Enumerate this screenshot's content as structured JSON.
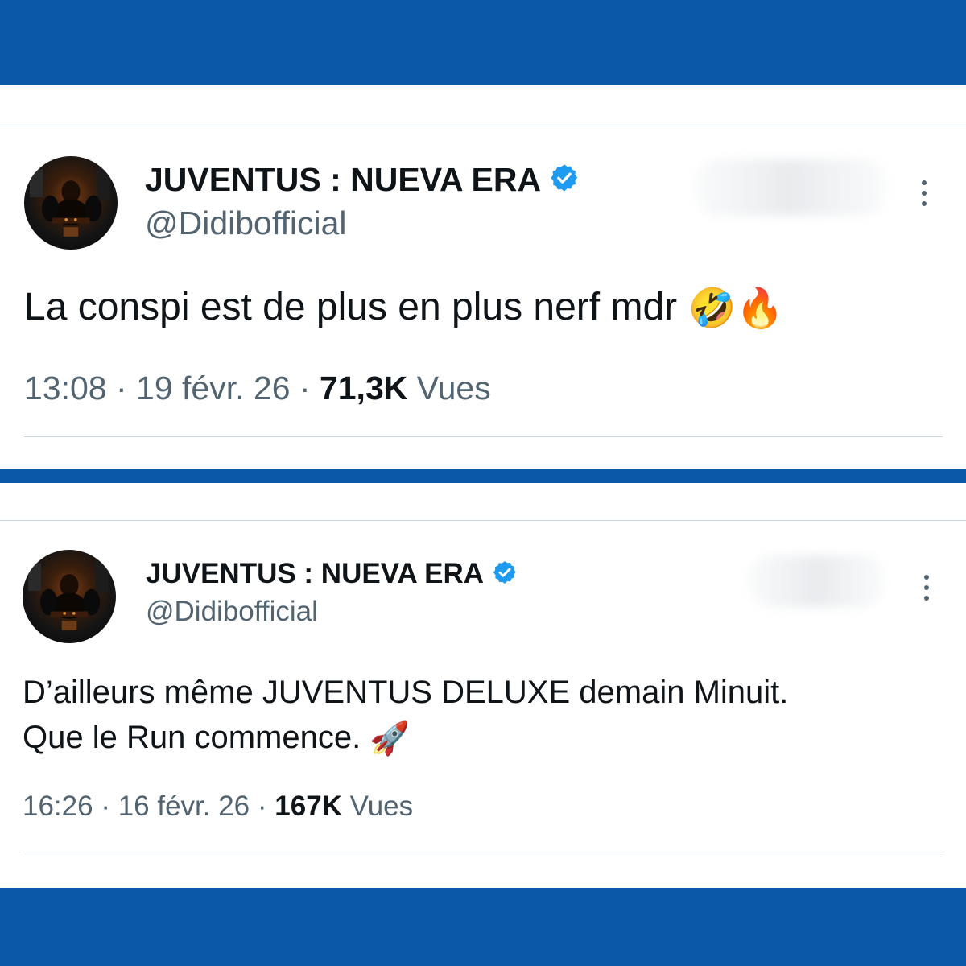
{
  "colors": {
    "band": "#0b57a8",
    "text_primary": "#0f1419",
    "text_secondary": "#536471",
    "verified": "#1d9bf0"
  },
  "tweets": [
    {
      "display_name": "JUVENTUS : NUEVA ERA",
      "handle": "@Didibofficial",
      "verified_icon": "verified-badge-icon",
      "text_lines": [
        "La conspi est de plus en plus nerf mdr"
      ],
      "emojis": [
        "🤣",
        "🔥"
      ],
      "time": "13:08",
      "sep1": " · ",
      "date": "19 févr. 26",
      "sep2": " · ",
      "views_count": "71,3K",
      "views_label": " Vues"
    },
    {
      "display_name": "JUVENTUS : NUEVA ERA",
      "handle": "@Didibofficial",
      "verified_icon": "verified-badge-icon",
      "text_lines": [
        "D’ailleurs même JUVENTUS DELUXE demain Minuit.",
        "Que le Run commence."
      ],
      "emojis": [
        "🚀"
      ],
      "time": "16:26",
      "sep1": " · ",
      "date": "16 févr. 26",
      "sep2": " · ",
      "views_count": "167K",
      "views_label": " Vues"
    }
  ]
}
